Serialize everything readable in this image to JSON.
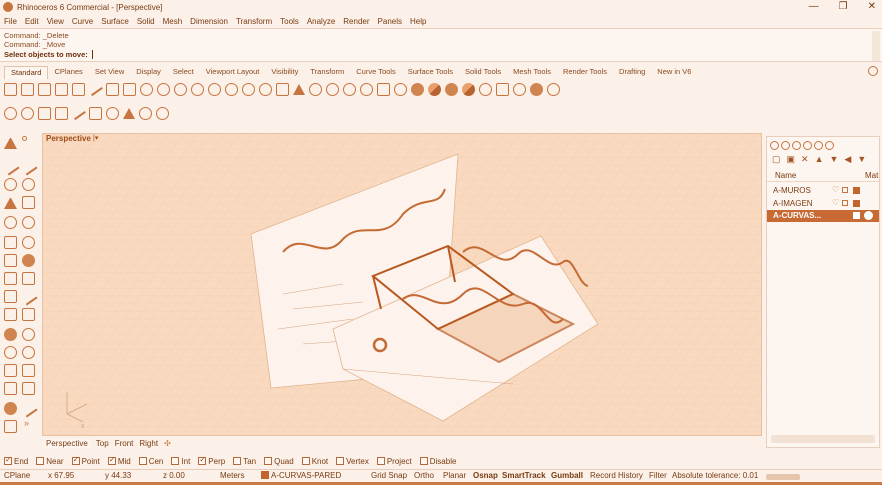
{
  "window": {
    "title": "Rhinoceros 6 Commercial - [Perspective]",
    "controls": [
      "—",
      "❐",
      "✕"
    ]
  },
  "menu": [
    "File",
    "Edit",
    "View",
    "Curve",
    "Surface",
    "Solid",
    "Mesh",
    "Dimension",
    "Transform",
    "Tools",
    "Analyze",
    "Render",
    "Panels",
    "Help"
  ],
  "command": {
    "history": [
      "Command: _Delete",
      "Command: _Move"
    ],
    "prompt": "Select objects to move:"
  },
  "toolbar_tabs": [
    "Standard",
    "CPlanes",
    "Set View",
    "Display",
    "Select",
    "Viewport Layout",
    "Visibility",
    "Transform",
    "Curve Tools",
    "Surface Tools",
    "Solid Tools",
    "Mesh Tools",
    "Render Tools",
    "Drafting",
    "New in V6"
  ],
  "viewport": {
    "name": "Perspective",
    "tabs": [
      "Perspective",
      "Top",
      "Front",
      "Right"
    ]
  },
  "osnap": [
    {
      "label": "End",
      "checked": true
    },
    {
      "label": "Near",
      "checked": false
    },
    {
      "label": "Point",
      "checked": true
    },
    {
      "label": "Mid",
      "checked": true
    },
    {
      "label": "Cen",
      "checked": false
    },
    {
      "label": "Int",
      "checked": false
    },
    {
      "label": "Perp",
      "checked": true
    },
    {
      "label": "Tan",
      "checked": false
    },
    {
      "label": "Quad",
      "checked": false
    },
    {
      "label": "Knot",
      "checked": false
    },
    {
      "label": "Vertex",
      "checked": false
    },
    {
      "label": "Project",
      "checked": false
    },
    {
      "label": "Disable",
      "checked": false
    }
  ],
  "status": {
    "cplane": "CPlane",
    "x": "x 67.95",
    "y": "y 44.33",
    "z": "z 0.00",
    "units": "Meters",
    "layer": "A-CURVAS-PARED",
    "grid_snap": "Grid Snap",
    "ortho": "Ortho",
    "planar": "Planar",
    "osnap": "Osnap",
    "smarttrack": "SmartTrack",
    "gumball": "Gumball",
    "record_history": "Record History",
    "filter": "Filter",
    "tolerance": "Absolute tolerance: 0.01"
  },
  "layers_panel": {
    "col_name": "Name",
    "col_mat": "Mat",
    "layers": [
      {
        "name": "A-MUROS",
        "selected": false
      },
      {
        "name": "A-IMAGEN",
        "selected": false
      },
      {
        "name": "A-CURVAS...",
        "selected": true
      }
    ]
  },
  "colors": {
    "accent": "#c8743f",
    "viewport_bg": "#f9d9bf",
    "selection": "#c76a33"
  }
}
